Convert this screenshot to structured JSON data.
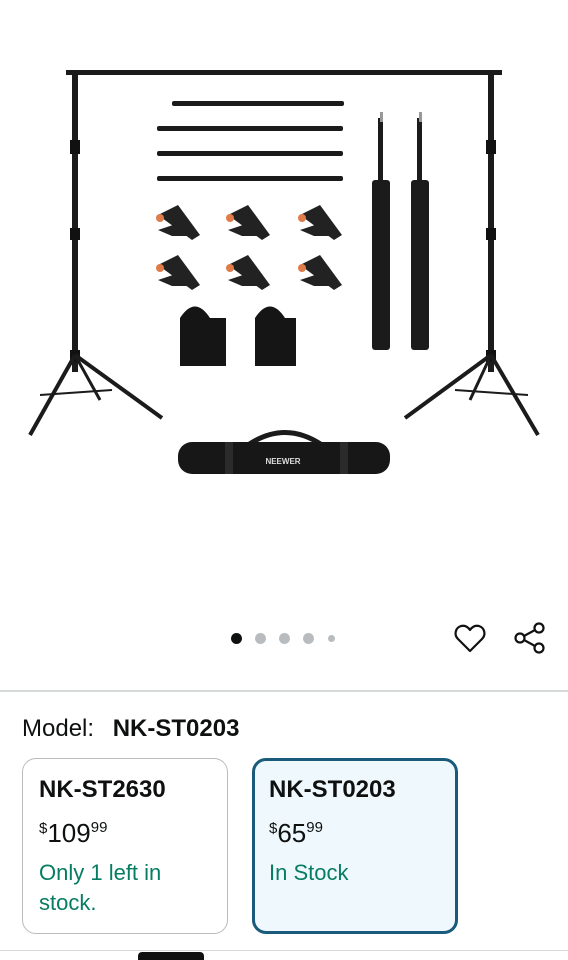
{
  "product_image": {
    "icon": "backdrop-stand-kit-image",
    "bag_brand_text": "NEEWER"
  },
  "carousel": {
    "total": 5,
    "active_index": 0
  },
  "actions": {
    "wishlist_icon": "heart-icon",
    "share_icon": "share-icon"
  },
  "model": {
    "label": "Model:",
    "value": "NK-ST0203"
  },
  "options": [
    {
      "name": "NK-ST2630",
      "currency": "$",
      "price_whole": "109",
      "price_fraction": "99",
      "stock": "Only 1 left in stock.",
      "selected": false
    },
    {
      "name": "NK-ST0203",
      "currency": "$",
      "price_whole": "65",
      "price_fraction": "99",
      "stock": "In Stock",
      "selected": true
    }
  ],
  "colors": {
    "stock_green": "#067d62",
    "selected_border": "#1a5a7a",
    "selected_bg": "#eff8fc"
  }
}
